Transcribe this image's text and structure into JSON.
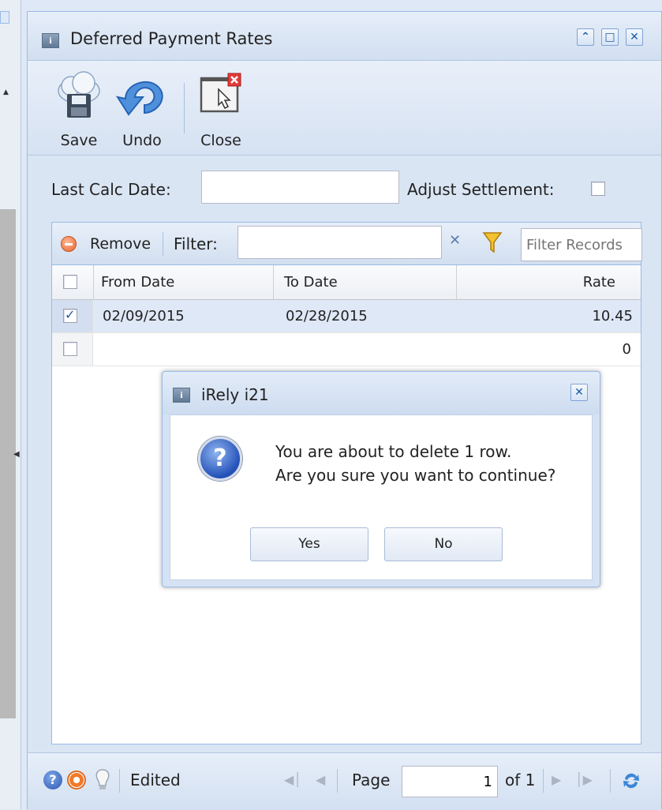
{
  "window": {
    "title": "Deferred Payment Rates"
  },
  "toolbar": {
    "save_label": "Save",
    "undo_label": "Undo",
    "close_label": "Close"
  },
  "form": {
    "last_calc_date_label": "Last Calc Date:",
    "last_calc_date_value": "",
    "adjust_settlement_label": "Adjust Settlement:",
    "adjust_settlement_checked": false
  },
  "grid": {
    "remove_label": "Remove",
    "filter_label": "Filter:",
    "filter_value": "",
    "filter_records_placeholder": "Filter Records",
    "columns": [
      "From Date",
      "To Date",
      "Rate"
    ],
    "rows": [
      {
        "from_date": "02/09/2015",
        "to_date": "02/28/2015",
        "rate": "10.45",
        "checked": true
      },
      {
        "from_date": "",
        "to_date": "",
        "rate": "0",
        "checked": false
      }
    ]
  },
  "footer": {
    "status": "Edited",
    "page_label": "Page",
    "page_value": "1",
    "of_label": "of 1"
  },
  "dialog": {
    "title": "iRely i21",
    "message_line1": "You are about to delete 1 row.",
    "message_line2": "Are you sure you want to continue?",
    "yes_label": "Yes",
    "no_label": "No"
  },
  "colors": {
    "panel_bg": "#dae5f3",
    "border": "#99bbe8",
    "selected_row": "#dfe8f6",
    "dialog_icon": "#2451b8"
  },
  "icons": {
    "window": "info-icon",
    "save": "save-cloud-icon",
    "undo": "undo-arrow-icon",
    "close": "close-window-icon",
    "remove": "remove-circle-icon",
    "filter_clear": "clear-x-icon",
    "filter_funnel": "funnel-icon",
    "dialog": "question-icon",
    "help": "help-icon",
    "support": "lifebuoy-icon",
    "tips": "lightbulb-icon",
    "refresh": "refresh-icon"
  }
}
